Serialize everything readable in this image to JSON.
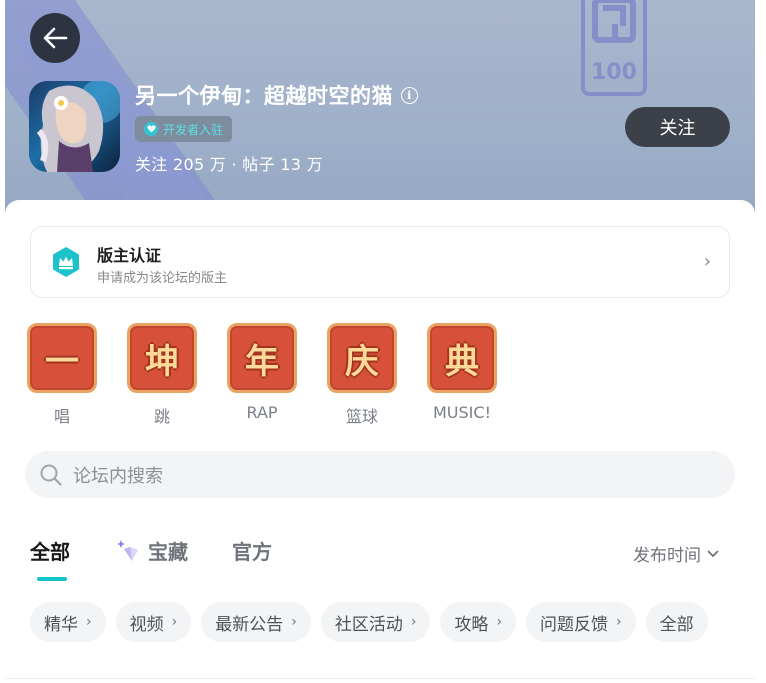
{
  "header": {
    "app_title": "另一个伊甸：超越时空的猫",
    "developer_badge": "开发者入驻",
    "stats": "关注 205 万 · 帖子 13 万",
    "follow_label": "关注",
    "badge_number": "100"
  },
  "moderator": {
    "title": "版主认证",
    "subtitle": "申请成为该论坛的版主"
  },
  "shortcuts": [
    {
      "tile": "一",
      "label": "唱"
    },
    {
      "tile": "坤",
      "label": "跳"
    },
    {
      "tile": "年",
      "label": "RAP"
    },
    {
      "tile": "庆",
      "label": "篮球"
    },
    {
      "tile": "典",
      "label": "MUSIC!"
    }
  ],
  "search": {
    "placeholder": "论坛内搜索"
  },
  "tabs": [
    {
      "label": "全部",
      "active": true
    },
    {
      "label": "宝藏",
      "active": false
    },
    {
      "label": "官方",
      "active": false
    }
  ],
  "sort": {
    "label": "发布时间"
  },
  "chips": [
    {
      "label": "精华"
    },
    {
      "label": "视频"
    },
    {
      "label": "最新公告"
    },
    {
      "label": "社区活动"
    },
    {
      "label": "攻略"
    },
    {
      "label": "问题反馈"
    },
    {
      "label": "全部"
    }
  ],
  "colors": {
    "accent": "#15c5ce",
    "follow_button": "#3c4048",
    "tile_red": "#d6503a"
  }
}
